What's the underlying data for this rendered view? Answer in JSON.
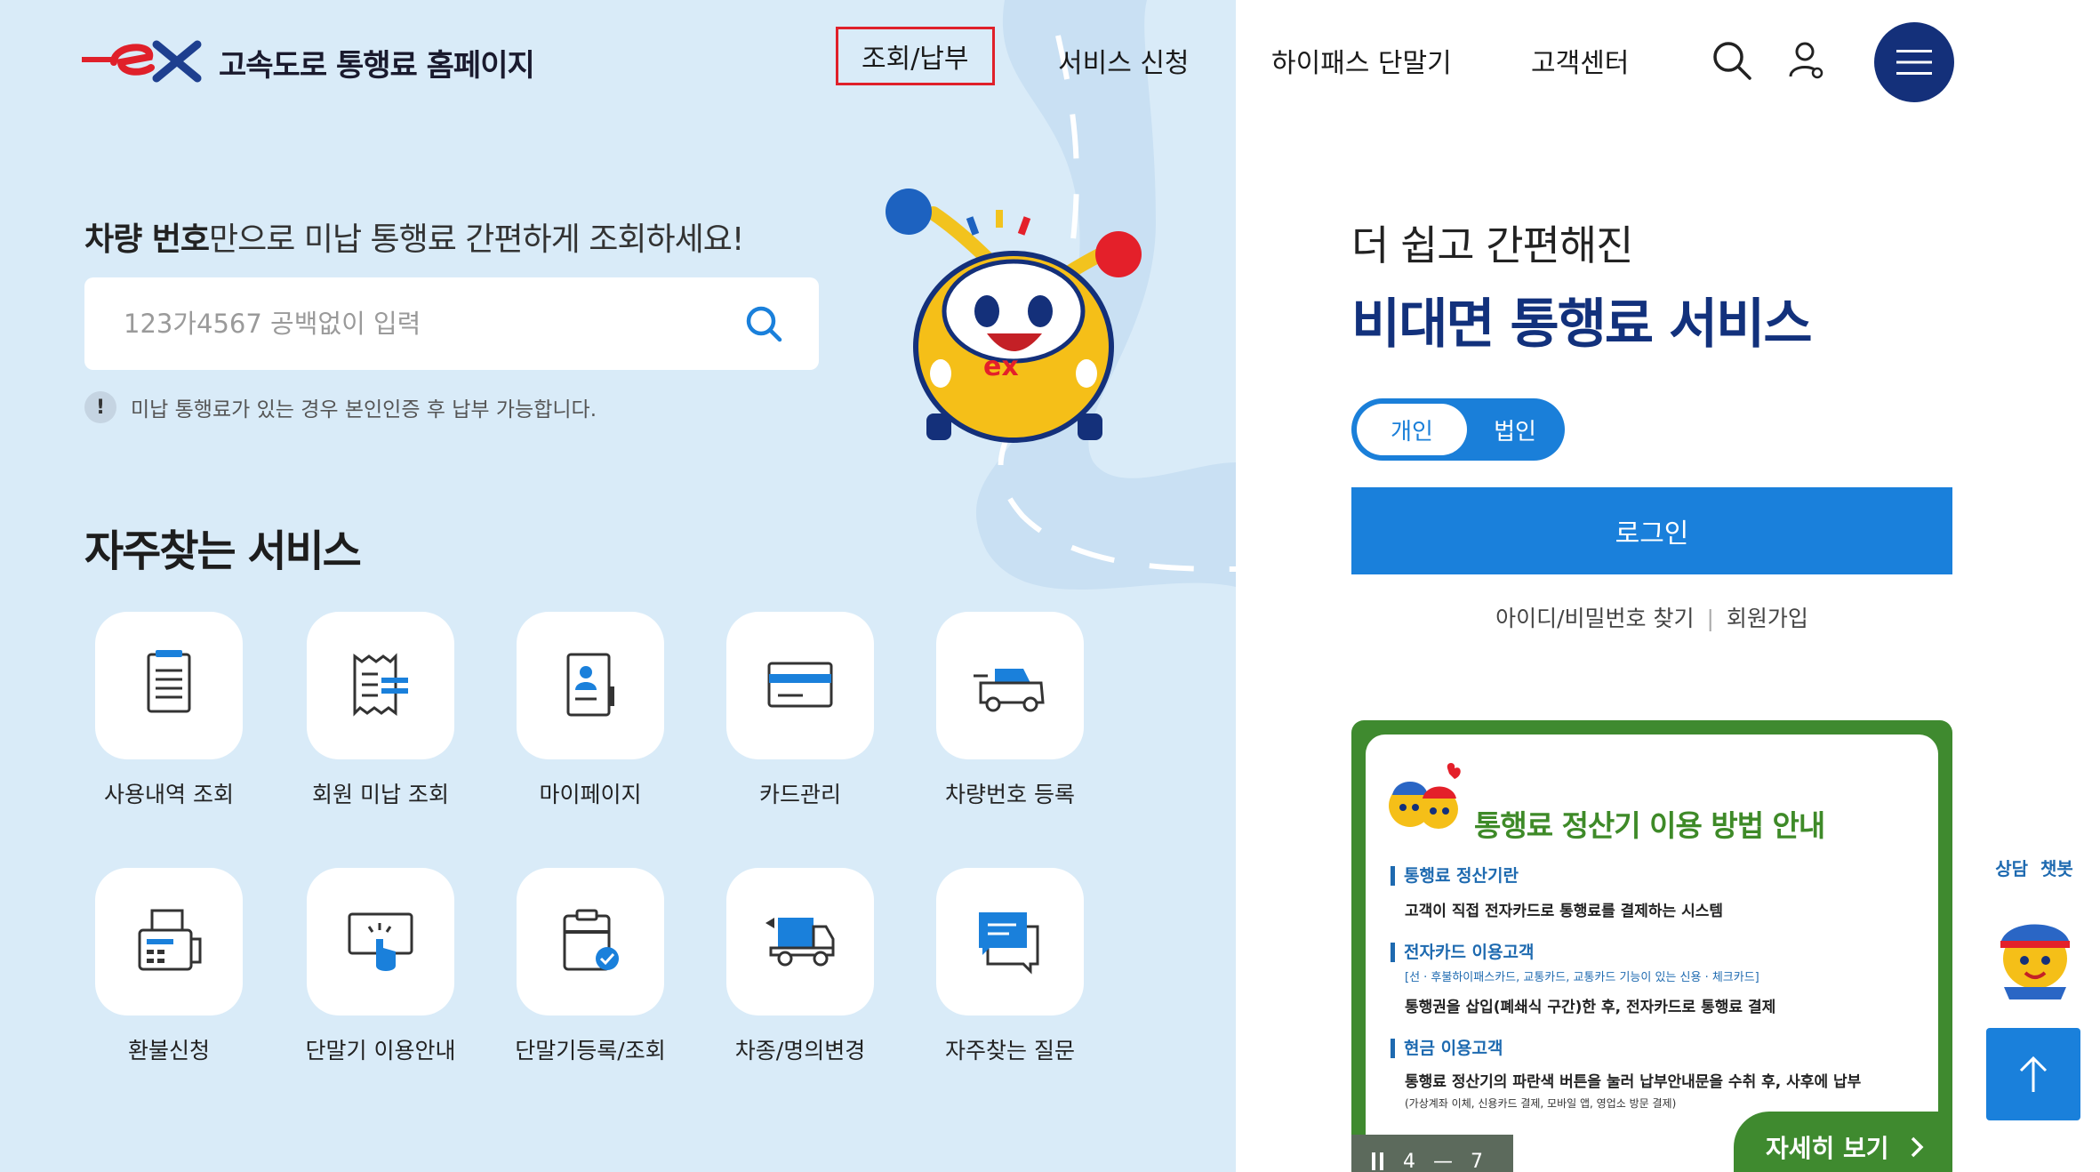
{
  "header": {
    "logo_text": "고속도로 통행료 홈페이지",
    "nav": [
      {
        "label": "조회/납부"
      },
      {
        "label": "서비스 신청"
      },
      {
        "label": "하이패스 단말기"
      },
      {
        "label": "고객센터"
      }
    ]
  },
  "search": {
    "heading_bold": "차량 번호",
    "heading_rest": "만으로 미납 통행료 간편하게 조회하세요!",
    "placeholder": "123가4567 공백없이 입력",
    "notice_icon": "!",
    "notice": "미납 통행료가 있는 경우 본인인증 후 납부 가능합니다."
  },
  "favorites": {
    "title": "자주찾는 서비스",
    "items": [
      {
        "label": "사용내역 조회",
        "icon": "document-list-icon"
      },
      {
        "label": "회원 미납 조회",
        "icon": "receipt-icon"
      },
      {
        "label": "마이페이지",
        "icon": "profile-book-icon"
      },
      {
        "label": "카드관리",
        "icon": "card-icon"
      },
      {
        "label": "차량번호 등록",
        "icon": "car-icon"
      },
      {
        "label": "환불신청",
        "icon": "fax-icon"
      },
      {
        "label": "단말기 이용안내",
        "icon": "touch-screen-icon"
      },
      {
        "label": "단말기등록/조회",
        "icon": "clipboard-check-icon"
      },
      {
        "label": "차종/명의변경",
        "icon": "truck-change-icon"
      },
      {
        "label": "자주찾는 질문",
        "icon": "chat-bubble-icon"
      }
    ]
  },
  "promo": {
    "subtitle": "더 쉽고 간편해진",
    "title": "비대면 통행료 서비스",
    "toggle": {
      "selected": "개인",
      "other": "법인"
    },
    "login": "로그인",
    "find_account": "아이디/비밀번호 찾기",
    "signup": "회원가입"
  },
  "banner": {
    "title": "통행료 정산기 이용 방법 안내",
    "sections": [
      {
        "heading": "통행료 정산기란",
        "text": "고객이 직접 전자카드로 통행료를 결제하는 시스템"
      },
      {
        "heading": "전자카드 이용고객",
        "note": "[선 · 후불하이패스카드, 교통카드, 교통카드 기능이 있는 신용 · 체크카드]",
        "text": "통행권을 삽입(폐쇄식 구간)한 후, 전자카드로 통행료 결제"
      },
      {
        "heading": "현금 이용고객",
        "text": "통행료 정산기의 파란색 버튼을 눌러 납부안내문을 수취 후, 사후에 납부",
        "note": "(가상계좌 이체, 신용카드 결제, 모바일 앱, 영업소 방문 결제)"
      }
    ],
    "pager_current": "4",
    "pager_sep": "—",
    "pager_total": "7",
    "more": "자세히 보기"
  },
  "chatbot": {
    "label1": "상담",
    "label2": "챗봇"
  },
  "colors": {
    "brand_navy": "#14307a",
    "accent_blue": "#1a80db",
    "left_bg": "#d9ebf8",
    "banner_green": "#3f8a2f",
    "active_red": "#e0202a"
  }
}
